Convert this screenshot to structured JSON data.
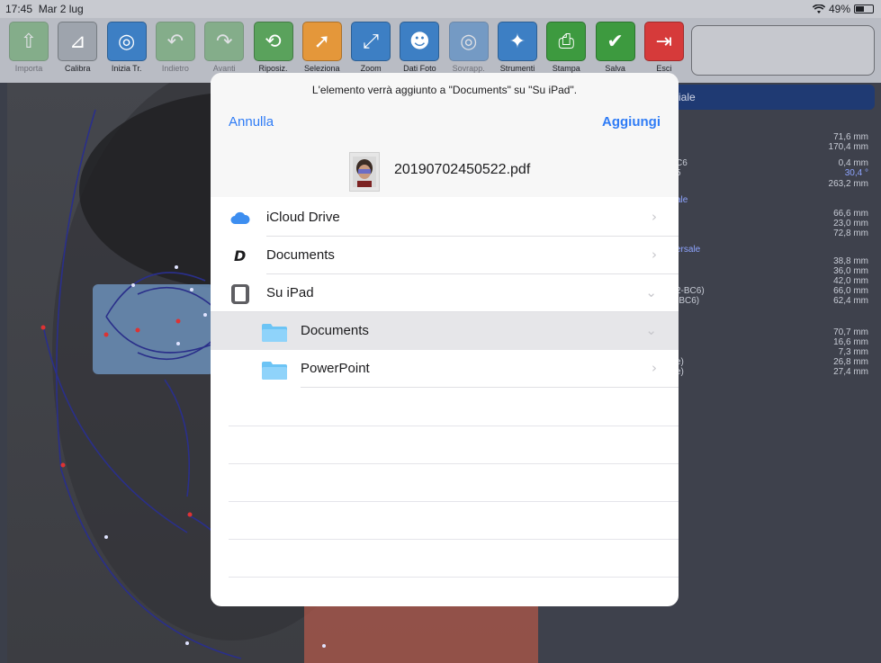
{
  "status_bar": {
    "time": "17:45",
    "date": "Mar 2 lug",
    "battery": "49%",
    "battery_level": 0.49,
    "wifi_icon": "wifi-icon"
  },
  "toolbar": {
    "buttons": [
      {
        "label": "Importa",
        "icon": "import-icon",
        "color": "#5aa25c",
        "enabled": false
      },
      {
        "label": "Calibra",
        "icon": "ruler-icon",
        "color": "#9ea4ad",
        "enabled": true
      },
      {
        "label": "Inizia Tr.",
        "icon": "target-icon",
        "color": "#3d7fc4",
        "enabled": true
      },
      {
        "label": "Indietro",
        "icon": "undo-icon",
        "color": "#5aa25c",
        "enabled": false
      },
      {
        "label": "Avanti",
        "icon": "redo-icon",
        "color": "#5aa25c",
        "enabled": false
      },
      {
        "label": "Riposiz.",
        "icon": "reposition-icon",
        "color": "#5aa25c",
        "enabled": true
      },
      {
        "label": "Seleziona",
        "icon": "select-arrow-icon",
        "color": "#e4973a",
        "enabled": true
      },
      {
        "label": "Zoom",
        "icon": "expand-icon",
        "color": "#3d7fc4",
        "enabled": true
      },
      {
        "label": "Dati Foto",
        "icon": "person-icon",
        "color": "#3d7fc4",
        "enabled": true
      },
      {
        "label": "Sovrapp.",
        "icon": "overlay-icon",
        "color": "#3d7fc4",
        "enabled": false
      },
      {
        "label": "Strumenti",
        "icon": "magic-wand-icon",
        "color": "#3d7fc4",
        "enabled": true
      },
      {
        "label": "Stampa",
        "icon": "print-icon",
        "color": "#3d9a3f",
        "enabled": true
      },
      {
        "label": "Salva",
        "icon": "check-icon",
        "color": "#3d9a3f",
        "enabled": true
      },
      {
        "label": "Esci",
        "icon": "exit-icon",
        "color": "#d63a3a",
        "enabled": true
      }
    ]
  },
  "report": {
    "header": "ciale",
    "values": [
      {
        "label": "",
        "value": "71,6 mm"
      },
      {
        "label": "",
        "value": "170,4 mm"
      },
      {
        "label": "C6",
        "value": "0,4 mm"
      },
      {
        "label": "5",
        "value": "30,4 °",
        "highlight": true
      },
      {
        "label": "",
        "value": "263,2 mm"
      },
      {
        "label": "ale",
        "value": ""
      },
      {
        "label": "",
        "value": "66,6 mm"
      },
      {
        "label": "",
        "value": "23,0 mm"
      },
      {
        "label": "",
        "value": "72,8 mm"
      },
      {
        "label": "ersale",
        "value": ""
      },
      {
        "label": "",
        "value": "38,8 mm"
      },
      {
        "label": "",
        "value": "36,0 mm"
      },
      {
        "label": "",
        "value": "42,0 mm"
      },
      {
        "label": "2-BC6)",
        "value": "66,0 mm"
      },
      {
        "label": "-BC6)",
        "value": "62,4 mm"
      },
      {
        "label": "",
        "value": "70,7 mm"
      },
      {
        "label": "",
        "value": "16,6 mm"
      },
      {
        "label": "",
        "value": "7,3 mm"
      },
      {
        "label": "e)",
        "value": "26,8 mm"
      },
      {
        "label": "e)",
        "value": "27,4 mm"
      }
    ]
  },
  "modal": {
    "message": "L'elemento verrà aggiunto a \"Documents\" su \"Su iPad\".",
    "cancel_label": "Annulla",
    "add_label": "Aggiungi",
    "file_name": "20190702450522.pdf",
    "locations": [
      {
        "label": "iCloud Drive",
        "icon": "icloud-icon",
        "chevron": "›"
      },
      {
        "label": "Documents",
        "icon": "documents-app-icon",
        "chevron": "›"
      },
      {
        "label": "Su iPad",
        "icon": "ipad-icon",
        "chevron": "⌄"
      },
      {
        "label": "Documents",
        "icon": "folder-icon",
        "chevron": "⌄",
        "selected": true
      },
      {
        "label": "PowerPoint",
        "icon": "folder-icon",
        "chevron": "›"
      }
    ],
    "accent_color": "#2f7cf6"
  }
}
